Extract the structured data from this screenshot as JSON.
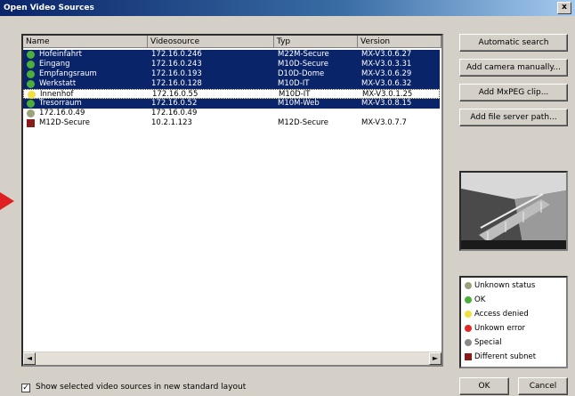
{
  "window": {
    "title": "Open Video Sources",
    "close_label": "x"
  },
  "list": {
    "columns": [
      "Name",
      "Videosource",
      "Typ",
      "Version"
    ],
    "rows": [
      {
        "status": "ok",
        "name": "Hofeinfahrt",
        "source": "172.16.0.246",
        "type": "M22M-Secure",
        "version": "MX-V3.0.6.27",
        "state": "sel"
      },
      {
        "status": "ok",
        "name": "Eingang",
        "source": "172.16.0.243",
        "type": "M10D-Secure",
        "version": "MX-V3.0.3.31",
        "state": "sel"
      },
      {
        "status": "ok",
        "name": "Empfangsraum",
        "source": "172.16.0.193",
        "type": "D10D-Dome",
        "version": "MX-V3.0.6.29",
        "state": "sel"
      },
      {
        "status": "ok",
        "name": "Werkstatt",
        "source": "172.16.0.128",
        "type": "M10D-IT",
        "version": "MX-V3.0.6.32",
        "state": "sel"
      },
      {
        "status": "denied",
        "name": "Innenhof",
        "source": "172.16.0.55",
        "type": "M10D-IT",
        "version": "MX-V3.0.1.25",
        "state": "focus"
      },
      {
        "status": "ok",
        "name": "Tresorraum",
        "source": "172.16.0.52",
        "type": "M10M-Web",
        "version": "MX-V3.0.8.15",
        "state": "sel"
      },
      {
        "status": "unknown",
        "name": "172.16.0.49",
        "source": "172.16.0.49",
        "type": "",
        "version": "",
        "state": ""
      },
      {
        "status": "subnet",
        "name": "M12D-Secure",
        "source": "10.2.1.123",
        "type": "M12D-Secure",
        "version": "MX-V3.0.7.7",
        "state": ""
      }
    ],
    "scroll_left": "◄",
    "scroll_right": "►"
  },
  "buttons": {
    "automatic_search": "Automatic search",
    "add_camera": "Add camera manually...",
    "add_mxpeg": "Add MxPEG clip...",
    "add_file_server": "Add file server path...",
    "ok": "OK",
    "cancel": "Cancel"
  },
  "legend": [
    {
      "key": "unknown",
      "label": "Unknown status"
    },
    {
      "key": "ok",
      "label": "OK"
    },
    {
      "key": "denied",
      "label": "Access denied"
    },
    {
      "key": "error",
      "label": "Unkown error"
    },
    {
      "key": "special",
      "label": "Special"
    },
    {
      "key": "subnet",
      "label": "Different subnet"
    }
  ],
  "colors": {
    "ok": "#4caf3a",
    "denied": "#f0e040",
    "error": "#e02828",
    "special": "#8a8a8a",
    "unknown": "#9aa27a",
    "subnet": "#8b1a1a",
    "selection": "#0a246a"
  },
  "options": {
    "checkbox_checked": true,
    "checkbox_mark": "✓",
    "checkbox_label": "Show selected video sources in new standard layout"
  }
}
